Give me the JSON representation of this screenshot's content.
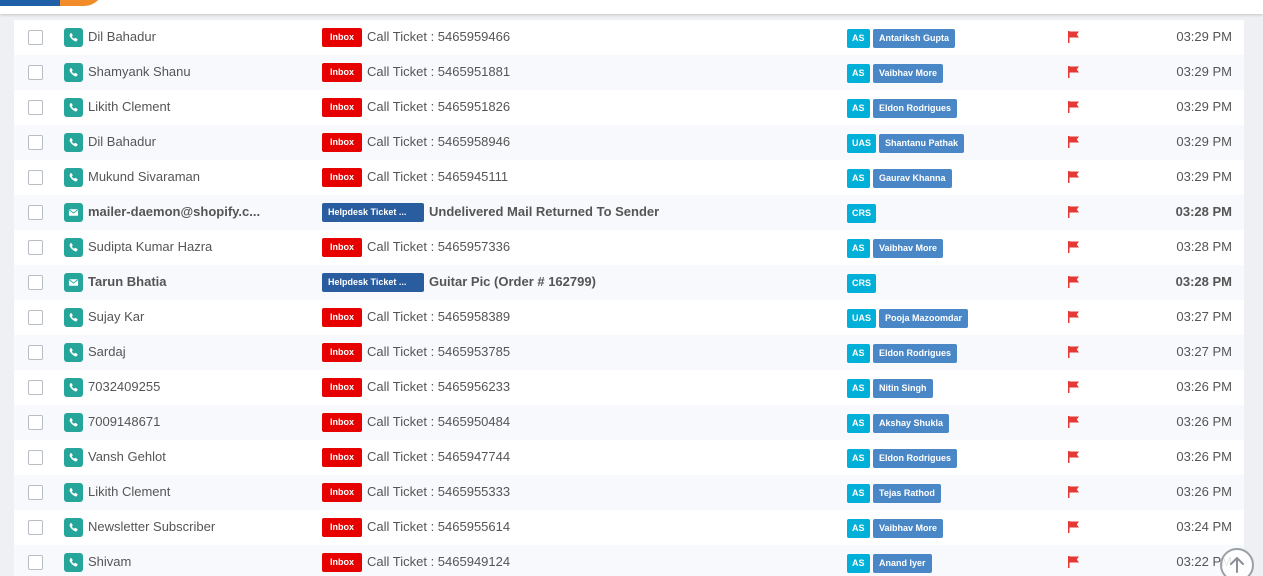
{
  "colors": {
    "phone_icon_bg": "#26a69a",
    "inbox_badge": "#e60000",
    "helpdesk_badge": "#2a5d9f",
    "team_badge": "#00b0d8",
    "agent_badge": "#4a87c6",
    "flag": "#e53935"
  },
  "rows": [
    {
      "type_icon": "phone-icon",
      "sender": "Dil Bahadur",
      "source": "Inbox",
      "subject": "Call Ticket : 5465959466",
      "team": "AS",
      "agent": "Antariksh Gupta",
      "time": "03:29 PM",
      "bold": false
    },
    {
      "type_icon": "phone-icon",
      "sender": "Shamyank Shanu",
      "source": "Inbox",
      "subject": "Call Ticket : 5465951881",
      "team": "AS",
      "agent": "Vaibhav More",
      "time": "03:29 PM",
      "bold": false
    },
    {
      "type_icon": "phone-icon",
      "sender": "Likith Clement",
      "source": "Inbox",
      "subject": "Call Ticket : 5465951826",
      "team": "AS",
      "agent": "Eldon Rodrigues",
      "time": "03:29 PM",
      "bold": false
    },
    {
      "type_icon": "phone-icon",
      "sender": "Dil Bahadur",
      "source": "Inbox",
      "subject": "Call Ticket : 5465958946",
      "team": "UAS",
      "agent": "Shantanu Pathak",
      "time": "03:29 PM",
      "bold": false
    },
    {
      "type_icon": "phone-icon",
      "sender": "Mukund Sivaraman",
      "source": "Inbox",
      "subject": "Call Ticket : 5465945111",
      "team": "AS",
      "agent": "Gaurav Khanna",
      "time": "03:29 PM",
      "bold": false
    },
    {
      "type_icon": "mail-icon",
      "sender": "mailer-daemon@shopify.c...",
      "source": "Helpdesk Ticket ...",
      "subject": "Undelivered Mail Returned To Sender",
      "team": "CRS",
      "agent": "",
      "time": "03:28 PM",
      "bold": true
    },
    {
      "type_icon": "phone-icon",
      "sender": "Sudipta Kumar Hazra",
      "source": "Inbox",
      "subject": "Call Ticket : 5465957336",
      "team": "AS",
      "agent": "Vaibhav More",
      "time": "03:28 PM",
      "bold": false
    },
    {
      "type_icon": "mail-icon",
      "sender": "Tarun Bhatia",
      "source": "Helpdesk Ticket ...",
      "subject": "Guitar Pic (Order # 162799)",
      "team": "CRS",
      "agent": "",
      "time": "03:28 PM",
      "bold": true
    },
    {
      "type_icon": "phone-icon",
      "sender": "Sujay Kar",
      "source": "Inbox",
      "subject": "Call Ticket : 5465958389",
      "team": "UAS",
      "agent": "Pooja Mazoomdar",
      "time": "03:27 PM",
      "bold": false
    },
    {
      "type_icon": "phone-icon",
      "sender": "Sardaj",
      "source": "Inbox",
      "subject": "Call Ticket : 5465953785",
      "team": "AS",
      "agent": "Eldon Rodrigues",
      "time": "03:27 PM",
      "bold": false
    },
    {
      "type_icon": "phone-icon",
      "sender": "7032409255",
      "source": "Inbox",
      "subject": "Call Ticket : 5465956233",
      "team": "AS",
      "agent": "Nitin Singh",
      "time": "03:26 PM",
      "bold": false
    },
    {
      "type_icon": "phone-icon",
      "sender": "7009148671",
      "source": "Inbox",
      "subject": "Call Ticket : 5465950484",
      "team": "AS",
      "agent": "Akshay Shukla",
      "time": "03:26 PM",
      "bold": false
    },
    {
      "type_icon": "phone-icon",
      "sender": "Vansh Gehlot",
      "source": "Inbox",
      "subject": "Call Ticket : 5465947744",
      "team": "AS",
      "agent": "Eldon Rodrigues",
      "time": "03:26 PM",
      "bold": false
    },
    {
      "type_icon": "phone-icon",
      "sender": "Likith Clement",
      "source": "Inbox",
      "subject": "Call Ticket : 5465955333",
      "team": "AS",
      "agent": "Tejas Rathod",
      "time": "03:26 PM",
      "bold": false
    },
    {
      "type_icon": "phone-icon",
      "sender": "Newsletter Subscriber",
      "source": "Inbox",
      "subject": "Call Ticket : 5465955614",
      "team": "AS",
      "agent": "Vaibhav More",
      "time": "03:24 PM",
      "bold": false
    },
    {
      "type_icon": "phone-icon",
      "sender": "Shivam",
      "source": "Inbox",
      "subject": "Call Ticket : 5465949124",
      "team": "AS",
      "agent": "Anand Iyer",
      "time": "03:22 PM",
      "bold": false
    }
  ],
  "scroll_top_icon": "arrow-up-icon"
}
